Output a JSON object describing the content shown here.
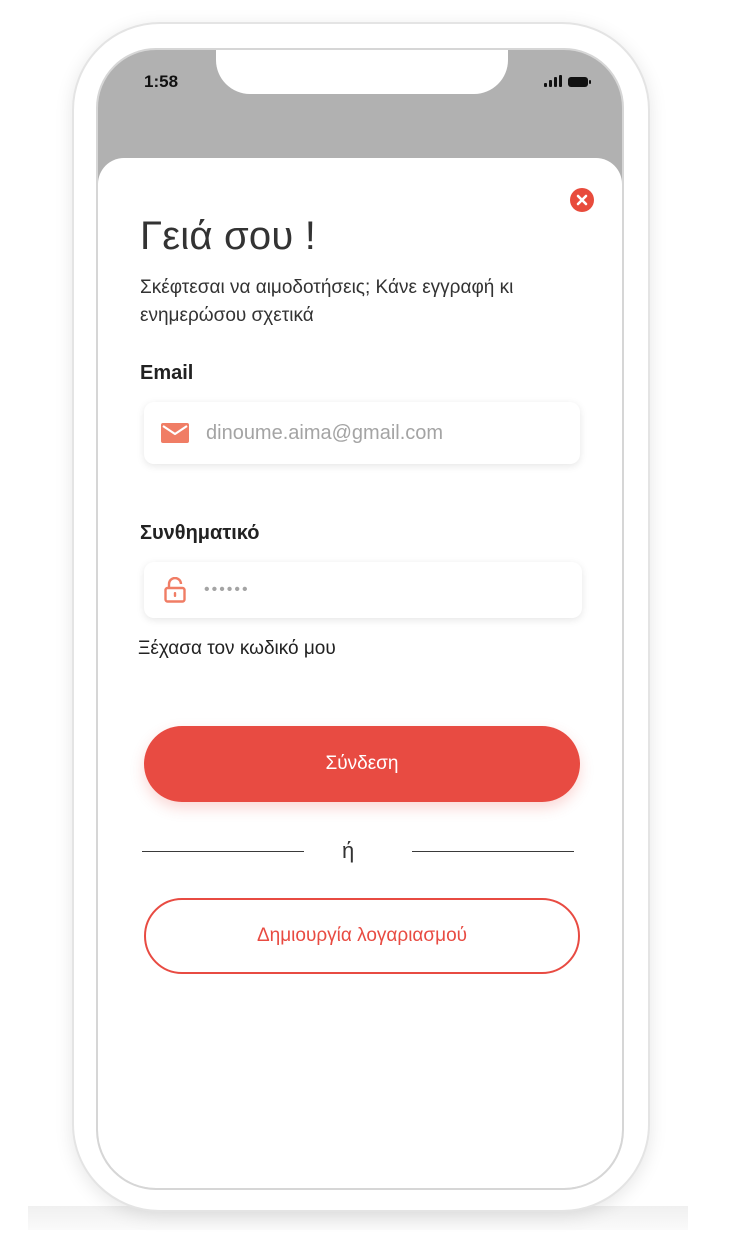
{
  "status_bar": {
    "time": "1:58",
    "signal_icon": "cellular-signal-icon",
    "battery_icon": "battery-icon"
  },
  "login_sheet": {
    "close_icon": "close-circle-icon",
    "title": "Γειά σου !",
    "subtitle": "Σκέφτεσαι να αιμοδοτήσεις; Κάνε εγγραφή κι ενημερώσου σχετικά",
    "email": {
      "label": "Email",
      "icon": "mail-icon",
      "placeholder": "dinoume.aima@gmail.com",
      "value": ""
    },
    "password": {
      "label": "Συνθηματικό",
      "icon": "lock-icon",
      "masked_value": "••••••"
    },
    "forgot_password": "Ξέχασα τον κωδικό μου",
    "login_button": "Σύνδεση",
    "divider_text": "ή",
    "create_account_button": "Δημιουργία λογαριασμού"
  },
  "colors": {
    "accent": "#e84b42",
    "backdrop": "#b1b1b1",
    "text": "#333333"
  }
}
